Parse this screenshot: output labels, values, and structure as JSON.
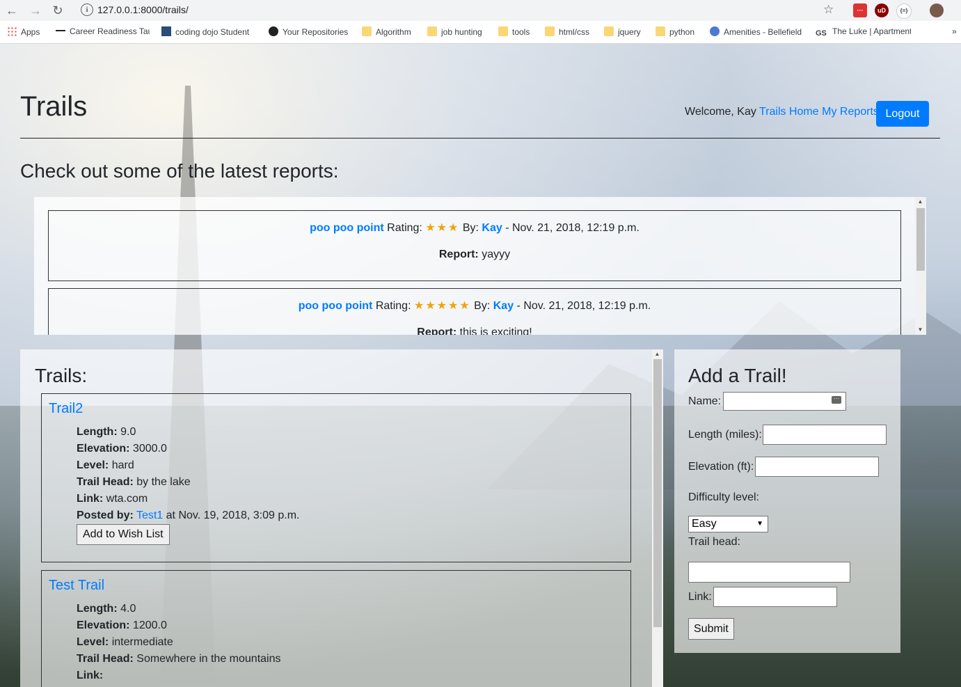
{
  "browser": {
    "url": "127.0.0.1:8000/trails/",
    "bookmarks": [
      "Apps",
      "Career Readiness Tau",
      "coding dojo Student",
      "Your Repositories",
      "Algorithm",
      "job hunting",
      "tools",
      "html/css",
      "jquery",
      "python",
      "Amenities - Bellefield",
      "The Luke | Apartment"
    ],
    "ext_labels": [
      "···",
      "uD",
      "{=}"
    ]
  },
  "header": {
    "title": "Trails",
    "welcome": "Welcome, Kay",
    "nav_home": "Trails Home",
    "nav_reports": "My Reports",
    "logout": "Logout"
  },
  "latest": {
    "title": "Check out some of the latest reports:",
    "reports": [
      {
        "trail": "poo poo point",
        "rating_label": "Rating:",
        "rating": 3,
        "stars": "★★★",
        "by_label": "By:",
        "author": "Kay",
        "date": "- Nov. 21, 2018, 12:19 p.m.",
        "report_label": "Report:",
        "report": "yayyy"
      },
      {
        "trail": "poo poo point",
        "rating_label": "Rating:",
        "rating": 5,
        "stars": "★★★★★",
        "by_label": "By:",
        "author": "Kay",
        "date": "- Nov. 21, 2018, 12:19 p.m.",
        "report_label": "Report:",
        "report": "this is exciting!"
      }
    ]
  },
  "trails": {
    "title": "Trails:",
    "items": [
      {
        "name": "Trail2",
        "length_label": "Length:",
        "length": "9.0",
        "elevation_label": "Elevation:",
        "elevation": "3000.0",
        "level_label": "Level:",
        "level": "hard",
        "head_label": "Trail Head:",
        "head": "by the lake",
        "link_label": "Link:",
        "link": "wta.com",
        "posted_label": "Posted by:",
        "poster": "Test1",
        "posted_at": "at Nov. 19, 2018, 3:09 p.m.",
        "wish_button": "Add to Wish List"
      },
      {
        "name": "Test Trail",
        "length_label": "Length:",
        "length": "4.0",
        "elevation_label": "Elevation:",
        "elevation": "1200.0",
        "level_label": "Level:",
        "level": "intermediate",
        "head_label": "Trail Head:",
        "head": "Somewhere in the mountains",
        "link_label": "Link:",
        "link": ""
      }
    ]
  },
  "add_trail": {
    "title": "Add a Trail!",
    "name_label": "Name:",
    "length_label": "Length (miles):",
    "elevation_label": "Elevation (ft):",
    "difficulty_label": "Difficulty level:",
    "difficulty_value": "Easy",
    "head_label": "Trail head:",
    "link_label": "Link:",
    "submit": "Submit"
  },
  "colors": {
    "link": "#007bff",
    "star": "#f0a30a",
    "button": "#007bff"
  }
}
